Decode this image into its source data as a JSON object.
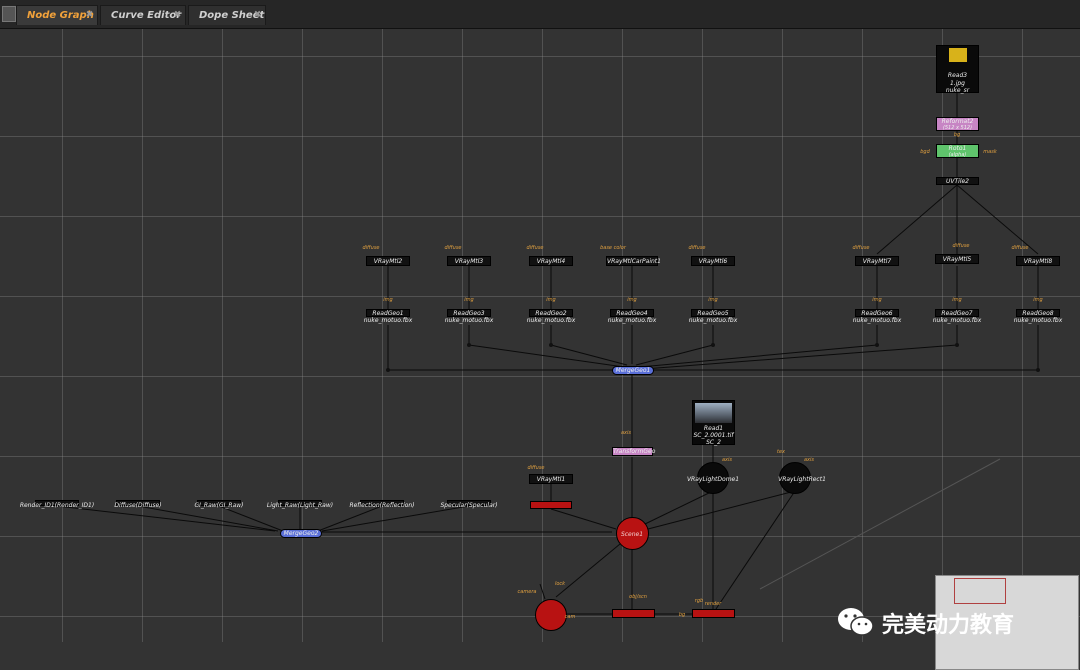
{
  "tabs": [
    {
      "label": "Node Graph",
      "active": true
    },
    {
      "label": "Curve Editor",
      "active": false
    },
    {
      "label": "Dope Sheet",
      "active": false
    }
  ],
  "tab_close_glyph": "✖",
  "nodes": {
    "read3": {
      "name": "Read3",
      "file": "1.jpg",
      "sub": "nuke_sr"
    },
    "reformat2": {
      "name": "Reformat2",
      "sub": "(512 x 512)"
    },
    "roto1": {
      "name": "Roto1",
      "sub": "(alpha)",
      "pin_left": "bgd",
      "pin_right": "mask",
      "pin_top": "bg"
    },
    "uvtile2": {
      "name": "UVTile2"
    },
    "mtls": [
      {
        "name": "VRayMtl2",
        "pin": "diffuse"
      },
      {
        "name": "VRayMtl3",
        "pin": "diffuse"
      },
      {
        "name": "VRayMtl4",
        "pin": "diffuse"
      },
      {
        "name": "VRayMtlCarPaint1",
        "pin": "base color"
      },
      {
        "name": "VRayMtl6",
        "pin": "diffuse"
      },
      {
        "name": "VRayMtl7",
        "pin": "diffuse"
      },
      {
        "name": "VRayMtl5",
        "pin": "diffuse"
      },
      {
        "name": "VRayMtl8",
        "pin": "diffuse"
      }
    ],
    "geos": [
      {
        "name": "ReadGeo1",
        "file": "nuke_motuo.fbx",
        "pin": "img"
      },
      {
        "name": "ReadGeo3",
        "file": "nuke_motuo.fbx",
        "pin": "img"
      },
      {
        "name": "ReadGeo2",
        "file": "nuke_motuo.fbx",
        "pin": "img"
      },
      {
        "name": "ReadGeo4",
        "file": "nuke_motuo.fbx",
        "pin": "img"
      },
      {
        "name": "ReadGeo5",
        "file": "nuke_motuo.fbx",
        "pin": "img"
      },
      {
        "name": "ReadGeo6",
        "file": "nuke_motuo.fbx",
        "pin": "img"
      },
      {
        "name": "ReadGeo7",
        "file": "nuke_motuo.fbx",
        "pin": "img"
      },
      {
        "name": "ReadGeo8",
        "file": "nuke_motuo.fbx",
        "pin": "img"
      }
    ],
    "mergegeo1": {
      "name": "MergeGeo1"
    },
    "read1": {
      "name": "Read1",
      "file": "SC_2.0001.tif",
      "sub": "SC_2"
    },
    "transformgeo": {
      "name": "TransformGeo",
      "pin": "axis"
    },
    "vraymtl1": {
      "name": "VRayMtl1",
      "pin": "diffuse"
    },
    "domelight": {
      "name": "VRayLightDome1",
      "pin": "axis"
    },
    "rectlight": {
      "name": "VRayLightRect1",
      "pin_a": "tex",
      "pin_b": "axis"
    },
    "scene": {
      "name": "Scene1"
    },
    "passes": [
      {
        "name": "Render_ID1(Render_ID1)"
      },
      {
        "name": "Diffuse(Diffuse)"
      },
      {
        "name": "GI_Raw(GI_Raw)"
      },
      {
        "name": "Light_Raw(Light_Raw)"
      },
      {
        "name": "Reflection(Reflection)"
      },
      {
        "name": "Specular(Specular)"
      }
    ],
    "mergegeo2": {
      "name": "MergeGeo2"
    },
    "bottom_pins": {
      "camera": "camera",
      "obj_scn": "obj/scn",
      "cam": "cam",
      "bg": "bg",
      "rgb": "rgb",
      "render": "render",
      "lock": "lock"
    }
  },
  "watermark": {
    "text": "完美动力教育",
    "logo": "wechat-icon"
  },
  "colors": {
    "accent": "#f2a23a",
    "pink": "#c785c4",
    "green": "#5fc46c",
    "blue": "#5a6fd8",
    "red": "#b81212"
  }
}
